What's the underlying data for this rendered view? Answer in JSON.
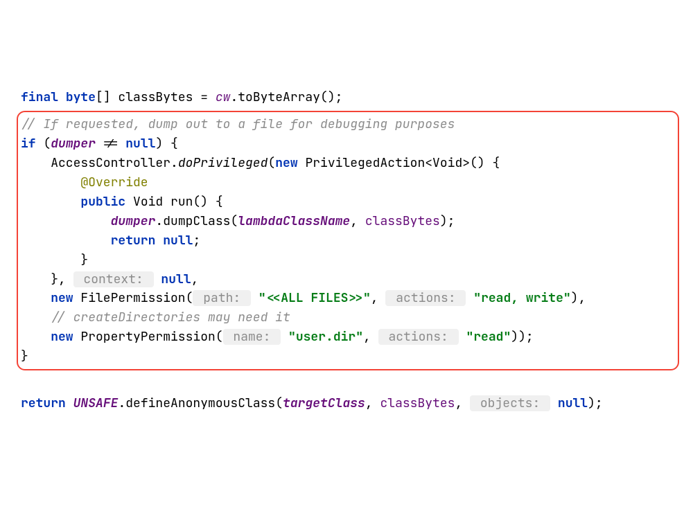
{
  "l1": {
    "final": "final",
    "byte": "byte",
    "brackets": "[]",
    "var": " classBytes = ",
    "cw": "cw",
    "call": ".toByteArray();"
  },
  "l3": {
    "comment": "// If requested, dump out to a file for debugging purposes"
  },
  "l4": {
    "if": "if",
    "open": " (",
    "dumper": "dumper",
    "neq": " != ",
    "null": "null",
    "close": ") {"
  },
  "l5": {
    "pre": "    AccessController.",
    "method": "doPrivileged",
    "open": "(",
    "new": "new",
    "rest": " PrivilegedAction<Void>() {"
  },
  "l6": {
    "anno": "        @Override"
  },
  "l7": {
    "pre": "        ",
    "public": "public",
    "rest": " Void run() {"
  },
  "l8": {
    "pre": "            ",
    "dumper": "dumper",
    "dot": ".dumpClass(",
    "p1": "lambdaClassName",
    "comma": ", ",
    "p2": "classBytes",
    "end": ");"
  },
  "l9": {
    "pre": "            ",
    "return": "return",
    "sp": " ",
    "null": "null",
    "semi": ";"
  },
  "l10": {
    "brace": "        }"
  },
  "l11": {
    "pre": "    }, ",
    "hint": " context: ",
    "null": "null",
    "comma": ","
  },
  "l12": {
    "pre": "    ",
    "new": "new",
    "cls": " FilePermission(",
    "h1": " path: ",
    "s1": "\"<<ALL FILES>>\"",
    "c1": ", ",
    "h2": " actions: ",
    "s2": "\"read, write\"",
    "end": "),"
  },
  "l13": {
    "comment": "    // createDirectories may need it"
  },
  "l14": {
    "pre": "    ",
    "new": "new",
    "cls": " PropertyPermission(",
    "h1": " name: ",
    "s1": "\"user.dir\"",
    "c1": ", ",
    "h2": " actions: ",
    "s2": "\"read\"",
    "end": "));"
  },
  "l15": {
    "brace": "}"
  },
  "l17": {
    "return": "return",
    "sp": " ",
    "unsafe": "UNSAFE",
    "call": ".defineAnonymousClass(",
    "p1": "targetClass",
    "c1": ", ",
    "p2": "classBytes",
    "c2": ", ",
    "hint": " objects: ",
    "null": "null",
    "end": ");"
  }
}
